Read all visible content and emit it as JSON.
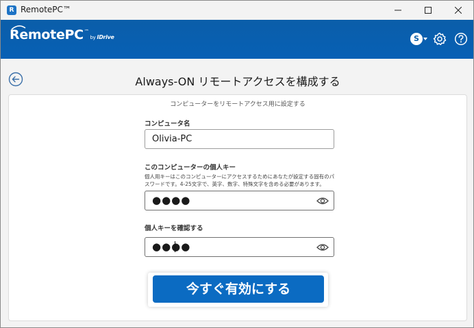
{
  "window": {
    "title": "RemotePC™"
  },
  "header": {
    "logo_text": "RemotePC",
    "logo_tm": "™",
    "logo_by": "by",
    "logo_idrive": "IDrive",
    "avatar_letter": "S",
    "icons": [
      "gear-icon",
      "help-icon"
    ]
  },
  "page": {
    "title": "Always-ON リモートアクセスを構成する"
  },
  "form": {
    "subtitle": "コンピューターをリモートアクセス用に設定する",
    "computer_name_label": "コンピュータ名",
    "computer_name_value": "Olivia-PC",
    "personal_key_label": "このコンピューターの個人キー",
    "personal_key_help": "個人用キーはこのコンピューターにアクセスするためにあなたが設定する固有のパスワードです。4-25文字で、英字、数字、特殊文字を含める必要があります。",
    "personal_key_value": "●●●●",
    "confirm_key_label": "個人キーを確認する",
    "confirm_key_value": "●●●●",
    "activate_button": "今すぐ有効にする"
  },
  "colors": {
    "header_blue": "#0b5ea9",
    "button_blue": "#0b6bc2"
  }
}
